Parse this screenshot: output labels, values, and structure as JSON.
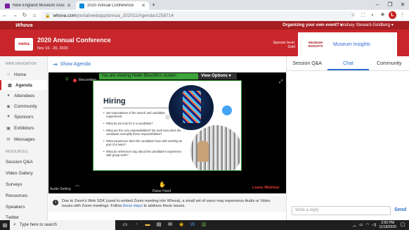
{
  "browser": {
    "tabs": [
      {
        "title": "New England Museum Associati",
        "favicon_color": "#7b1fa2"
      },
      {
        "title": "2020 Annual Conference",
        "favicon_color": "#0288d1"
      }
    ],
    "new_tab": "+",
    "url_host": "whova.com",
    "url_path": "/portal/webapp/annua_202011/Agenda/1258714",
    "window_controls": [
      "–",
      "❐",
      "✕"
    ],
    "profile_initial": "L"
  },
  "header": {
    "brand": "Whova",
    "own_event": "Organizing your own event? ▾",
    "user": "Lindsey Steward-Goldberg ▾"
  },
  "banner": {
    "logo_text": "nema",
    "title": "2020 Annual Conference",
    "dates": "Nov 16 - 20, 2020",
    "sponsor_label": "Sponsor level: Gold",
    "sponsor_logo": "MUSEUM INSIGHTS",
    "sponsor_name": "Museum Insights"
  },
  "sidebar": {
    "nav_heading": "MAIN NAVIGATION",
    "items": [
      {
        "label": "Home",
        "icon": "⌂"
      },
      {
        "label": "Agenda",
        "icon": "▦"
      },
      {
        "label": "Attendees",
        "icon": "●"
      },
      {
        "label": "Community",
        "icon": "◉"
      },
      {
        "label": "Sponsors",
        "icon": "♥"
      },
      {
        "label": "Exhibitors",
        "icon": "▣"
      },
      {
        "label": "Messages",
        "icon": "✉"
      }
    ],
    "resources_heading": "RESOURCES",
    "resources": [
      "Session Q&A",
      "Video Gallery",
      "Surveys",
      "Resources",
      "Speakers",
      "Twitter"
    ]
  },
  "main": {
    "show_agenda": "Show Agenda",
    "share_message": "You are viewing Helen Brechlin's screen",
    "view_options": "View Options ▾",
    "recording": "Recording...",
    "slide": {
      "title": "Hiring",
      "bullets": [
        "Set expectations of the search and candidate requirement.",
        "What do we look for in a candidate?",
        "What are the core responsibilities? Be real! How does the candidate exemplify these responsibilities?",
        "What experience does the candidate have with working as part of a team?",
        "What do references say about this candidate's experience with group work?"
      ]
    },
    "audio_setting": "Audio Setting",
    "raise_hand": "Raise Hand",
    "leave": "Leave Webinar",
    "notice_text": "Due to Zoom's Web SDK (used to embed Zoom meeting into Whova), a small set of users may experience Audio or Video issues with Zoom meetings. Follow",
    "notice_link": "these steps",
    "notice_tail": "to address these issues."
  },
  "right_panel": {
    "tabs": [
      "Session Q&A",
      "Chat",
      "Community"
    ],
    "active_tab": "Chat",
    "reply_placeholder": "Write a reply",
    "send": "Send"
  },
  "taskbar": {
    "search_placeholder": "Type here to search",
    "time": "2:50 PM",
    "date": "11/18/2020"
  }
}
